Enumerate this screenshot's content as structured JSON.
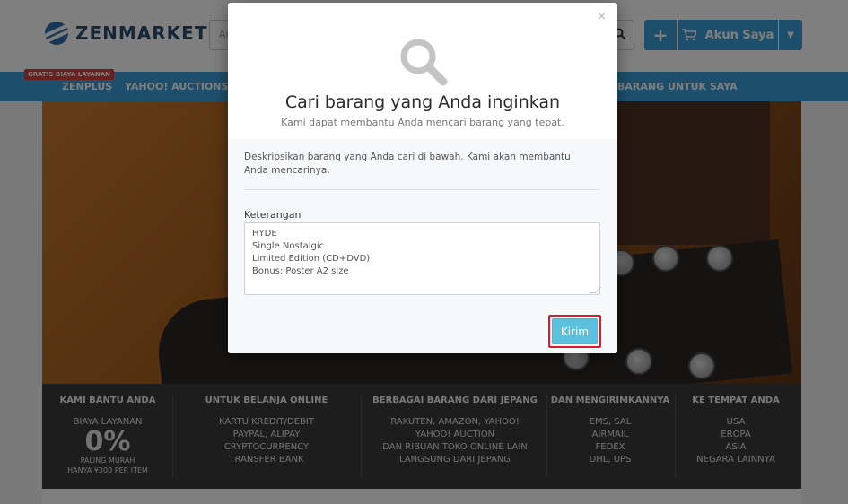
{
  "header": {
    "logo_text": "ZENMARKET",
    "search_placeholder": "Ar",
    "account_label": "Akun Saya"
  },
  "nav": {
    "promo_badge": "GRATIS BIAYA LAYANAN",
    "items": [
      "ZENPLUS",
      "YAHOO! AUCTIONS",
      "BARANG UNTUK SAYA"
    ]
  },
  "info_strip": {
    "columns": [
      {
        "title": "KAMI BANTU ANDA",
        "lines": [
          "BIAYA LAYANAN"
        ],
        "big": "0%",
        "small": [
          "PALING MURAH",
          "HANYA ¥300 PER ITEM"
        ]
      },
      {
        "title": "UNTUK BELANJA ONLINE",
        "lines": [
          "KARTU KREDIT/DEBIT",
          "PAYPAL, ALIPAY",
          "CRYPTOCURRENCY",
          "TRANSFER BANK"
        ]
      },
      {
        "title": "BERBAGAI BARANG DARI JEPANG",
        "lines": [
          "RAKUTEN, AMAZON, YAHOO!",
          "YAHOO! AUCTION",
          "DAN RIBUAN TOKO ONLINE LAIN",
          "LANGSUNG DARI JEPANG"
        ]
      },
      {
        "title": "DAN MENGIRIMKANNYA",
        "lines": [
          "EMS, SAL",
          "AIRMAIL",
          "FEDEX",
          "DHL, UPS"
        ]
      },
      {
        "title": "KE TEMPAT ANDA",
        "lines": [
          "USA",
          "EROPA",
          "ASIA",
          "NEGARA LAINNYA"
        ]
      }
    ]
  },
  "modal": {
    "close_symbol": "×",
    "title": "Cari barang yang Anda inginkan",
    "subtitle": "Kami dapat membantu Anda mencari barang yang tepat.",
    "description": "Deskripsikan barang yang Anda cari di bawah. Kami akan membantu Anda mencarinya.",
    "field_label": "Keterangan",
    "field_value": "HYDE\nSingle Nostalgic\nLimited Edition (CD+DVD)\nBonus: Poster A2 size",
    "submit_label": "Kirim"
  },
  "colors": {
    "accent": "#3a9fd8",
    "submit": "#5bc0de",
    "highlight_border": "#e0192a",
    "promo": "#d9403b"
  }
}
